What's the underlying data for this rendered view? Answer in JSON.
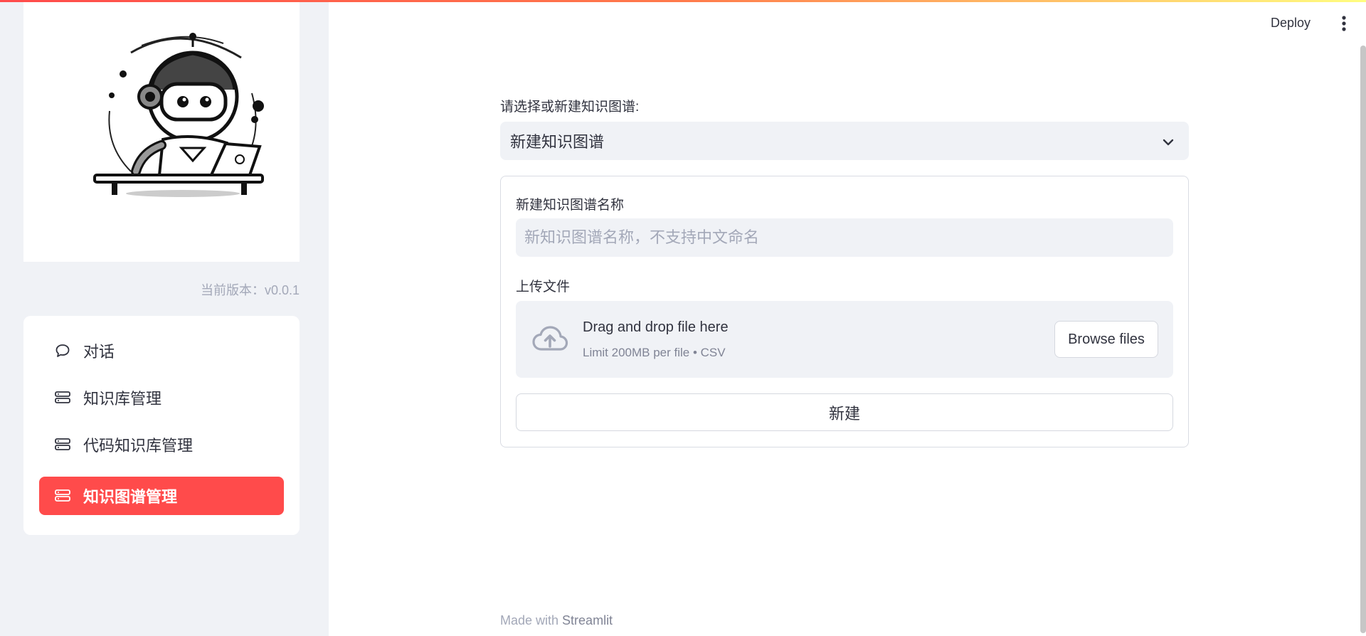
{
  "header": {
    "deploy_label": "Deploy",
    "menu_icon": "kebab-menu-icon"
  },
  "sidebar": {
    "logo_icon": "robot-logo",
    "version_text": "当前版本：v0.0.1",
    "items": [
      {
        "label": "对话",
        "icon": "chat-bubble-icon",
        "active": false
      },
      {
        "label": "知识库管理",
        "icon": "database-icon",
        "active": false
      },
      {
        "label": "代码知识库管理",
        "icon": "database-icon",
        "active": false
      },
      {
        "label": "知识图谱管理",
        "icon": "database-icon",
        "active": true
      }
    ]
  },
  "main": {
    "select_label": "请选择或新建知识图谱:",
    "select_value": "新建知识图谱",
    "form": {
      "name_label": "新建知识图谱名称",
      "name_value": "",
      "name_placeholder": "新知识图谱名称，不支持中文命名",
      "upload_label": "上传文件",
      "upload": {
        "title": "Drag and drop file here",
        "subtitle": "Limit 200MB per file • CSV",
        "browse_label": "Browse files",
        "icon": "cloud-upload-icon"
      },
      "submit_label": "新建"
    }
  },
  "footer": {
    "prefix": "Made with ",
    "brand": "Streamlit"
  },
  "colors": {
    "accent": "#ff4b4b",
    "sidebar_bg": "#f0f2f6",
    "text": "#31333f",
    "muted": "#a3a8b8"
  }
}
